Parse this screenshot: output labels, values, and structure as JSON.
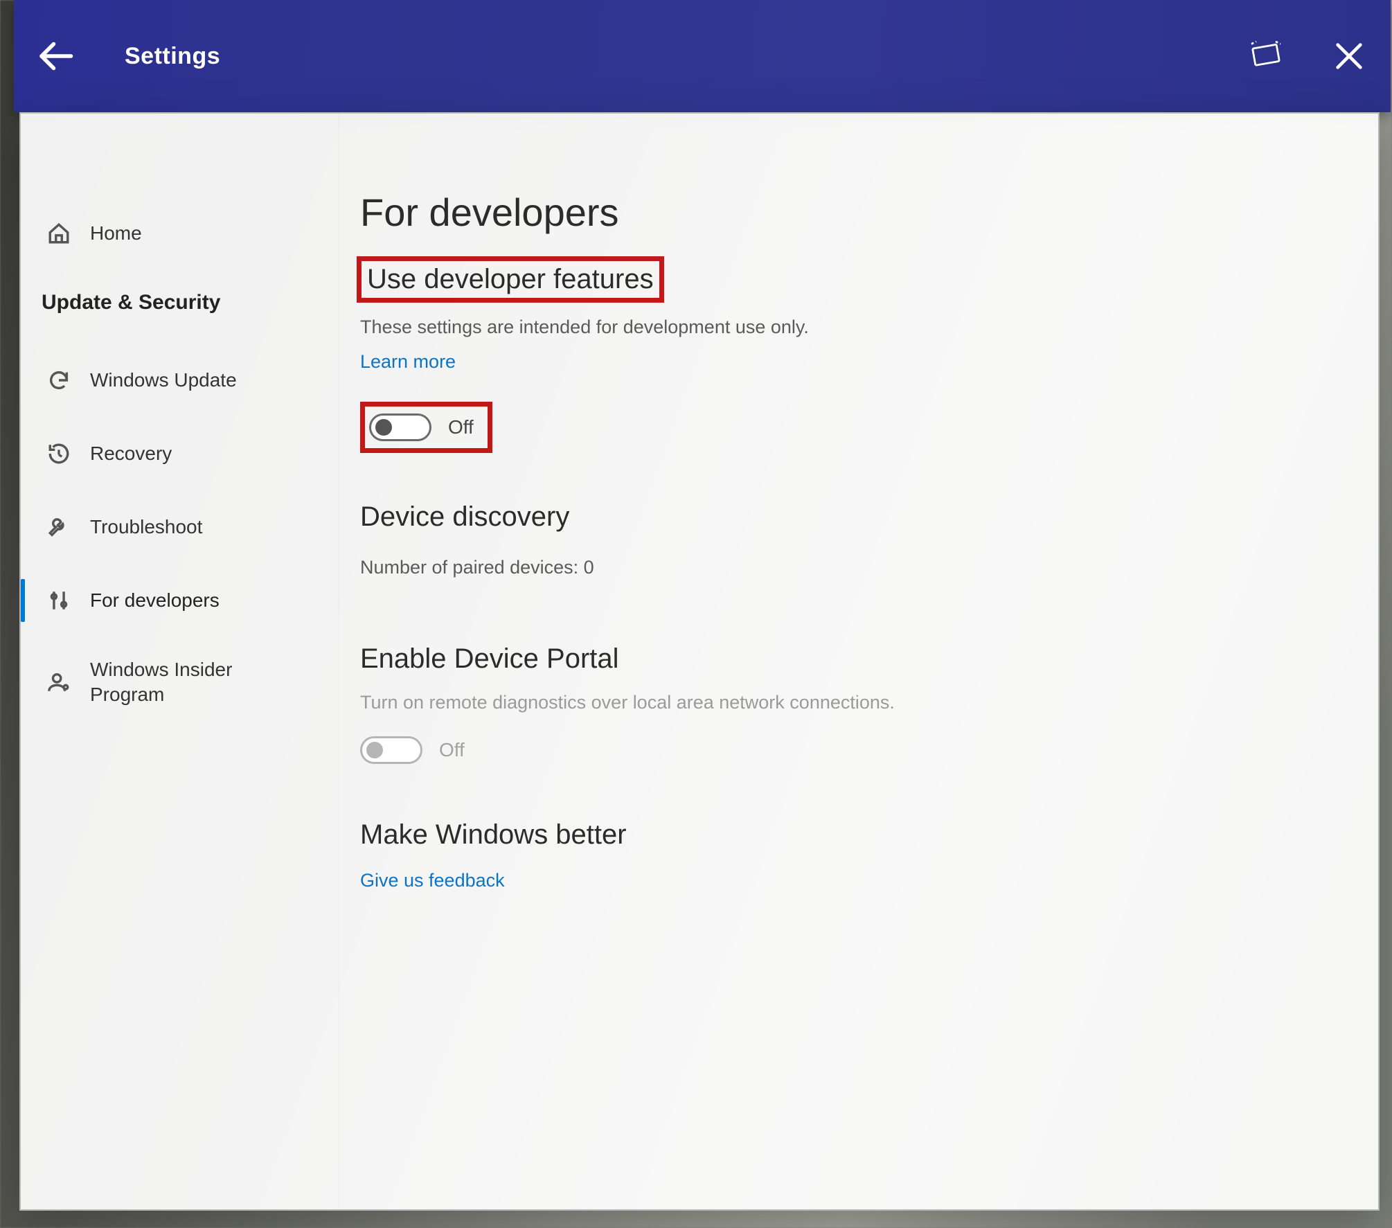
{
  "titlebar": {
    "title": "Settings"
  },
  "sidebar": {
    "home_label": "Home",
    "category_label": "Update & Security",
    "items": [
      {
        "id": "windows-update",
        "label": "Windows Update"
      },
      {
        "id": "recovery",
        "label": "Recovery"
      },
      {
        "id": "troubleshoot",
        "label": "Troubleshoot"
      },
      {
        "id": "for-developers",
        "label": "For developers",
        "selected": true
      },
      {
        "id": "insider",
        "label": "Windows Insider Program"
      }
    ]
  },
  "main": {
    "page_title": "For developers",
    "dev_features": {
      "heading": "Use developer features",
      "description": "These settings are intended for development use only.",
      "learn_more": "Learn more",
      "toggle_state": "Off"
    },
    "device_discovery": {
      "heading": "Device discovery",
      "paired_label": "Number of paired devices: 0"
    },
    "device_portal": {
      "heading": "Enable Device Portal",
      "description": "Turn on remote diagnostics over local area network connections.",
      "toggle_state": "Off"
    },
    "feedback": {
      "heading": "Make Windows better",
      "link": "Give us feedback"
    }
  }
}
